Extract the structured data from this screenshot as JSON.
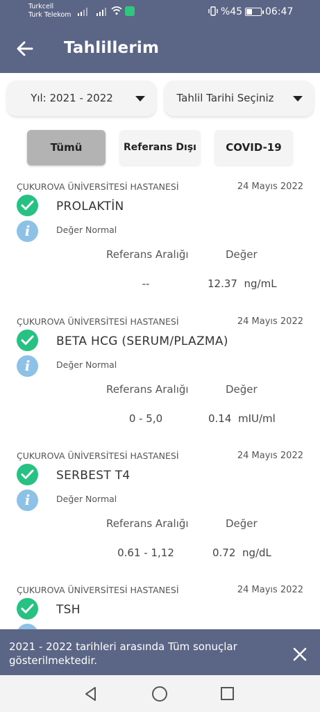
{
  "status_bar": {
    "carrier1": "Turkcell",
    "carrier2": "Turk Telekom",
    "battery_text": "%45",
    "time": "06:47"
  },
  "header": {
    "title": "Tahlillerim"
  },
  "filters": {
    "year_label": "Yıl: 2021 - 2022",
    "date_label": "Tahlil Tarihi Seçiniz"
  },
  "tabs": [
    {
      "label": "Tümü",
      "selected": true
    },
    {
      "label": "Referans Dışı",
      "selected": false
    },
    {
      "label": "COVID-19",
      "selected": false
    }
  ],
  "results": [
    {
      "hospital": "ÇUKUROVA ÜNİVERSİTESİ HASTANESİ",
      "date": "24 Mayıs 2022",
      "test": "PROLAKTİN",
      "status": "Değer Normal",
      "ref_label": "Referans Aralığı",
      "val_label": "Değer",
      "ref_value": "--",
      "value": "12.37",
      "unit": "ng/mL"
    },
    {
      "hospital": "ÇUKUROVA ÜNİVERSİTESİ HASTANESİ",
      "date": "24 Mayıs 2022",
      "test": "BETA HCG (SERUM/PLAZMA)",
      "status": "Değer Normal",
      "ref_label": "Referans Aralığı",
      "val_label": "Değer",
      "ref_value": "0 - 5,0",
      "value": "0.14",
      "unit": "mIU/ml"
    },
    {
      "hospital": "ÇUKUROVA ÜNİVERSİTESİ HASTANESİ",
      "date": "24 Mayıs 2022",
      "test": "SERBEST T4",
      "status": "Değer Normal",
      "ref_label": "Referans Aralığı",
      "val_label": "Değer",
      "ref_value": "0.61 - 1,12",
      "value": "0.72",
      "unit": "ng/dL"
    },
    {
      "hospital": "ÇUKUROVA ÜNİVERSİTESİ HASTANESİ",
      "date": "24 Mayıs 2022",
      "test": "TSH"
    }
  ],
  "snackbar": {
    "message": "2021 - 2022 tarihleri arasında Tüm sonuçlar gösterilmektedir."
  },
  "colors": {
    "header": "#5b6686",
    "check": "#27c283",
    "info": "#8ec1e6",
    "tab_selected": "#b3b3b3"
  },
  "icons": [
    "back-arrow-icon",
    "caret-down-icon",
    "check-circle-icon",
    "info-icon",
    "close-icon",
    "nav-back-icon",
    "nav-home-icon",
    "nav-recent-icon"
  ]
}
